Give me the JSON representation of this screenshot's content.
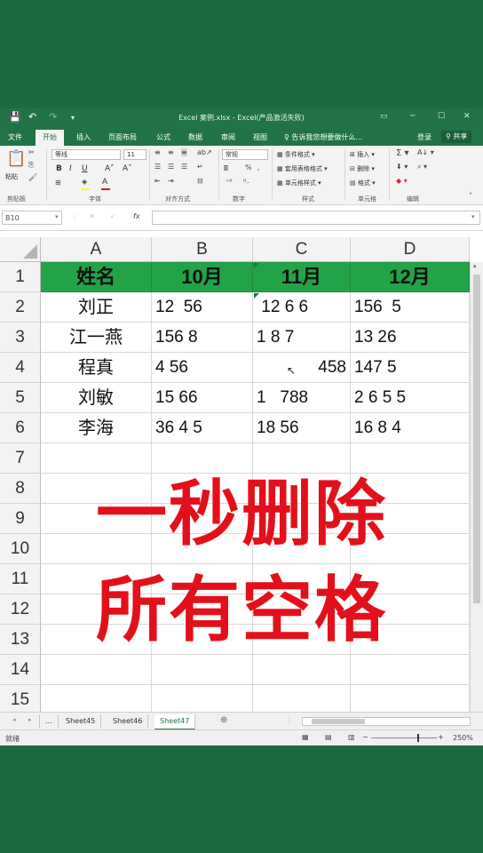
{
  "titlebar": {
    "title": "Excel 案例.xlsx - Excel(产品激活失败)",
    "save_icon": "💾",
    "undo_icon": "↶",
    "redo_icon": "↷",
    "qa_more": "▾"
  },
  "tabs": [
    "文件",
    "开始",
    "插入",
    "页面布局",
    "公式",
    "数据",
    "审阅",
    "视图"
  ],
  "active_tab": "开始",
  "tell_me": "告诉我您想要做什么...",
  "login": "登录",
  "share": "共享",
  "ribbon": {
    "paste": "粘贴",
    "font_name": "等线",
    "font_size": "11",
    "number_format": "常规",
    "cond_format": "条件格式",
    "table_format": "套用表格格式",
    "cell_style": "单元格样式",
    "insert": "插入",
    "delete": "删除",
    "format": "格式",
    "groups": [
      "剪贴板",
      "字体",
      "对齐方式",
      "数字",
      "样式",
      "单元格",
      "编辑"
    ],
    "font_color": "#e3101b",
    "fill_color": "#ffff00"
  },
  "formula_bar": {
    "name_box": "B10",
    "formula": "",
    "fx": "fx"
  },
  "columns": [
    "A",
    "B",
    "C",
    "D"
  ],
  "rows": [
    "1",
    "2",
    "3",
    "4",
    "5",
    "6",
    "7",
    "8",
    "9",
    "10",
    "11",
    "12",
    "13",
    "14",
    "15"
  ],
  "header_row": [
    "姓名",
    "10月",
    "11月",
    "12月"
  ],
  "data_rows": [
    [
      "刘正",
      "12  56",
      " 12 6 6",
      "156  5"
    ],
    [
      "江一燕",
      "156 8",
      "1 8 7",
      "13 26"
    ],
    [
      "程真",
      "4 56",
      "458",
      "147 5"
    ],
    [
      "刘敏",
      "15 66",
      "1   788",
      "2 6 5 5"
    ],
    [
      "李海",
      "36 4 5",
      "18 56",
      "16 8 4"
    ]
  ],
  "overlay": {
    "line1": "一秒删除",
    "line2": "所有空格",
    "color": "#e3101b"
  },
  "sheet_tabs": [
    "Sheet45",
    "Sheet46",
    "Sheet47"
  ],
  "active_sheet": "Sheet47",
  "sheet_more": "...",
  "status": {
    "ready": "就绪",
    "zoom": "250%"
  },
  "colors": {
    "excel_green": "#217346",
    "header_fill": "#23a348",
    "background": "#1d6b40"
  }
}
